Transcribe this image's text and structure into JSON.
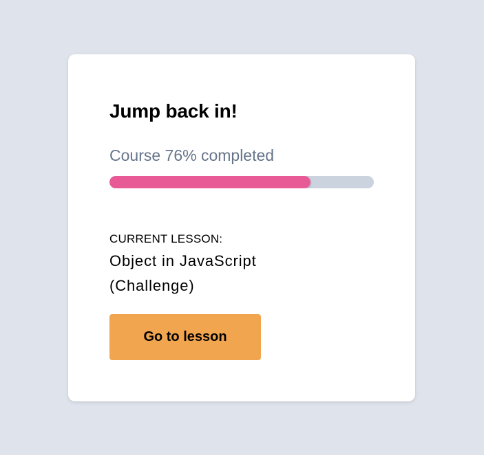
{
  "card": {
    "title": "Jump back in!",
    "progress": {
      "label": "Course 76% completed",
      "percent": 76,
      "fill_color": "#e85a96",
      "track_color": "#cbd3de"
    },
    "lesson": {
      "caption": "CURRENT LESSON:",
      "name": "Object in JavaScript (Challenge)"
    },
    "button": {
      "label": "Go to lesson",
      "color": "#f2a54f"
    }
  }
}
